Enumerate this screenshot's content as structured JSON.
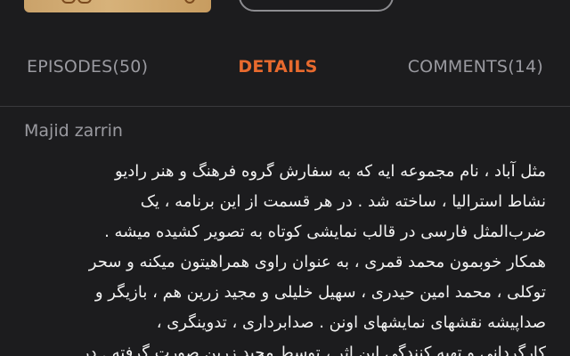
{
  "tabs": [
    {
      "label": "EPISODES(50)"
    },
    {
      "label": "DETAILS"
    },
    {
      "label": "COMMENTS(14)"
    }
  ],
  "active_tab": "DETAILS",
  "details": {
    "author": "Majid zarrin",
    "description": "مثل آباد ، نام مجموعه ایه که به سفارش  گروه فرهنگ و هنر رادیو\nنشاط استرالیا ، ساخته شد . در هر قسمت از این برنامه ، یک\nضرب‌المثل فارسی در قالب نمایشی کوتاه به تصویر کشیده میشه .\nهمکار خوبمون محمد قمری ، به عنوان راوی همراهیتون میکنه و سحر\nتوکلی ، محمد امین حیدری ، سهیل خلیلی و مجید زرین هم ،  بازیگر و\nصداپیشه  نقشهای نمایشهای اونن . صدابرداری ، تدوینگری ،\nکارگردانی و تهیه کنندگی این اثر ، توسط مجید زرین صورت گرفته . در"
  },
  "colors": {
    "background": "#1c1c1e",
    "accent": "#e86a2e",
    "muted_text": "#9a9aa0",
    "body_text": "#f2f2f2"
  }
}
